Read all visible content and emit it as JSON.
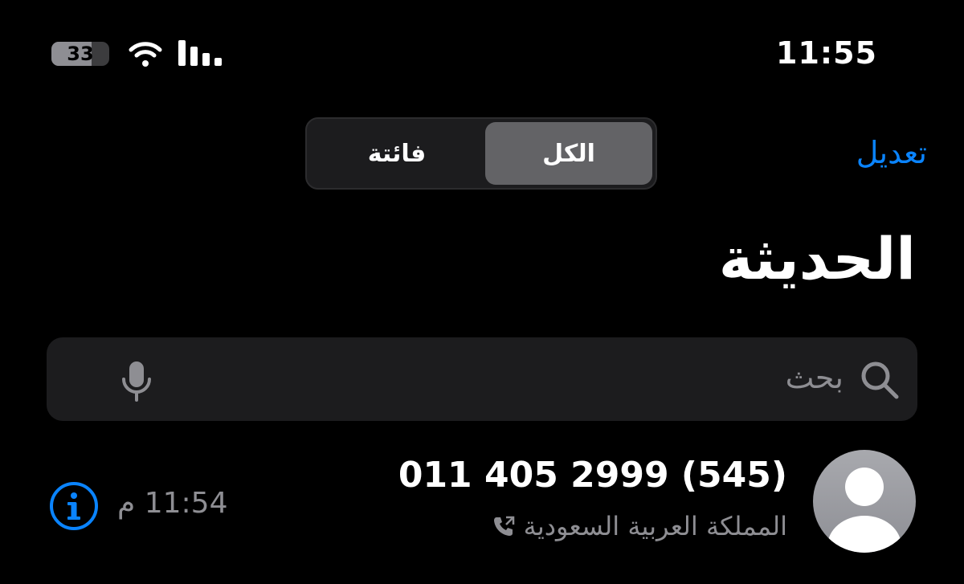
{
  "status_bar": {
    "battery_level": "33",
    "time": "11:55"
  },
  "header": {
    "segment_all": "الكل",
    "segment_missed": "فائتة",
    "edit_label": "تعديل",
    "title": "الحديثة"
  },
  "search": {
    "placeholder": "بحث"
  },
  "recents": [
    {
      "number": "011 405 2999 (545)",
      "location": "المملكة العربية السعودية",
      "time": "11:54 م"
    }
  ],
  "colors": {
    "accent": "#0a84ff",
    "background": "#000000",
    "secondary_text": "#8e8e93"
  }
}
